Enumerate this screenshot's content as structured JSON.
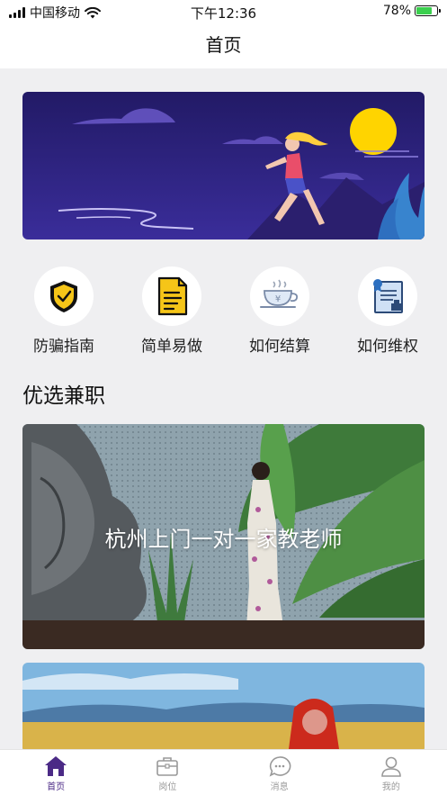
{
  "status_bar": {
    "carrier": "中国移动",
    "time": "下午12:36",
    "battery": "78%",
    "battery_level": 0.78
  },
  "header": {
    "title": "首页"
  },
  "quick_menu": [
    {
      "label": "防骗指南",
      "icon": "shield-check-icon"
    },
    {
      "label": "简单易做",
      "icon": "document-icon"
    },
    {
      "label": "如何结算",
      "icon": "coffee-cup-icon"
    },
    {
      "label": "如何维权",
      "icon": "certificate-icon"
    }
  ],
  "section": {
    "title": "优选兼职"
  },
  "jobs": [
    {
      "title": "杭州上门一对一家教老师"
    },
    {
      "title": ""
    }
  ],
  "tab_bar": [
    {
      "label": "首页",
      "icon": "home-icon",
      "active": true
    },
    {
      "label": "岗位",
      "icon": "briefcase-icon",
      "active": false
    },
    {
      "label": "消息",
      "icon": "chat-icon",
      "active": false
    },
    {
      "label": "我的",
      "icon": "user-icon",
      "active": false
    }
  ],
  "colors": {
    "accent": "#4b2a86",
    "banner_bg": "#2a1f73",
    "moon": "#ffd400"
  }
}
